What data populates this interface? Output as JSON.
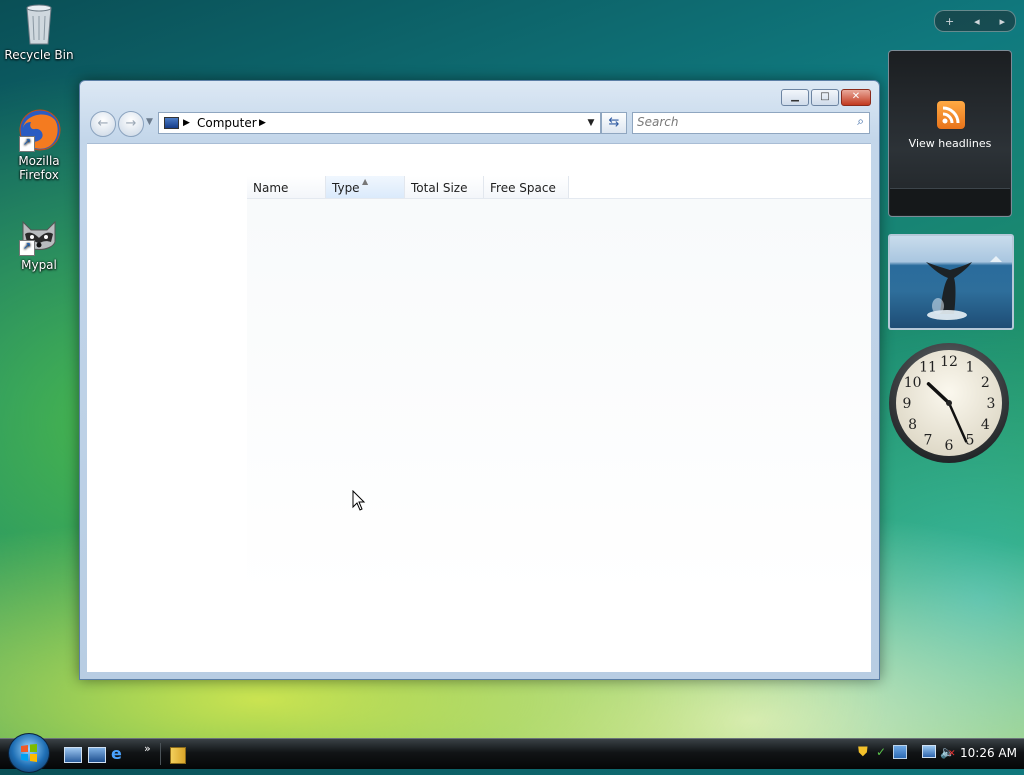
{
  "desktop": {
    "icons": [
      {
        "label": "Recycle Bin"
      },
      {
        "label": "Mozilla\nFirefox"
      },
      {
        "label": "Mypal"
      }
    ]
  },
  "window": {
    "breadcrumb": "Computer",
    "search_placeholder": "Search",
    "columns": [
      "Name",
      "Type",
      "Total Size",
      "Free Space"
    ],
    "sorted_column": "Type"
  },
  "gadgets": {
    "feed_label": "View headlines",
    "clock": {
      "hour": 10,
      "minute": 26,
      "numbers": [
        "12",
        "1",
        "2",
        "3",
        "4",
        "5",
        "6",
        "7",
        "8",
        "9",
        "10",
        "11"
      ]
    }
  },
  "taskbar": {
    "time": "10:26 AM",
    "ql_more": "»"
  },
  "colors": {
    "window_frame": "#c3d6ea",
    "accent": "#2f5aa1",
    "feed_orange": "#e8731a"
  }
}
